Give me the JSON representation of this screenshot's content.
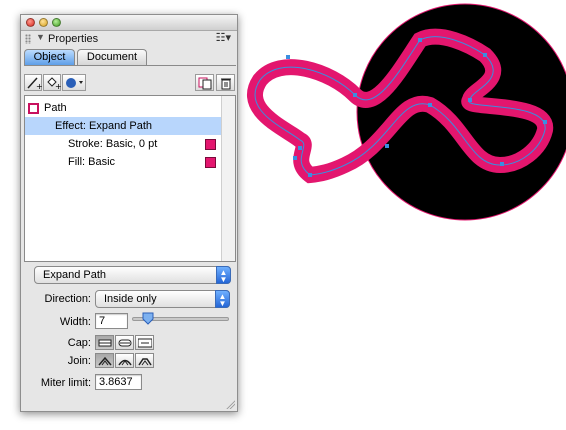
{
  "panel": {
    "title": "Properties",
    "tabs": [
      {
        "label": "Object",
        "active": true
      },
      {
        "label": "Document",
        "active": false
      }
    ],
    "tree": [
      {
        "label": "Path",
        "icon": "path-square-icon"
      },
      {
        "label": "Effect: Expand Path",
        "selected": true
      },
      {
        "label": "Stroke: Basic, 0 pt",
        "swatch": "#e3166e"
      },
      {
        "label": "Fill: Basic",
        "swatch": "#e3166e"
      }
    ],
    "effect_popup": "Expand Path",
    "direction": {
      "label": "Direction:",
      "value": "Inside only"
    },
    "width": {
      "label": "Width:",
      "value": "7",
      "slider_fraction": 0.12
    },
    "cap": {
      "label": "Cap:",
      "selected_index": 0,
      "options": [
        "butt-cap-icon",
        "round-cap-icon",
        "square-cap-icon"
      ]
    },
    "join": {
      "label": "Join:",
      "selected_index": 0,
      "options": [
        "miter-join-icon",
        "round-join-icon",
        "bevel-join-icon"
      ]
    },
    "miter_limit": {
      "label": "Miter limit:",
      "value": "3.8637"
    }
  },
  "colors": {
    "accent_blue": "#5f9fe8",
    "stroke_magenta": "#e3166e",
    "circle_fill": "#000000"
  }
}
